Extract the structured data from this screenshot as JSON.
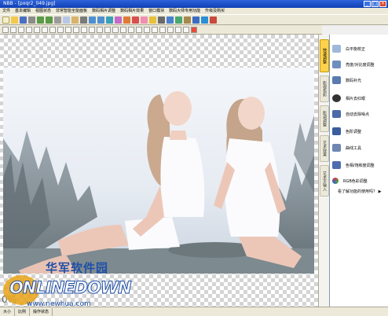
{
  "window": {
    "title": "NBB - [pxqr2_049.jpg]",
    "buttons": [
      "_",
      "□",
      "×"
    ]
  },
  "menu": [
    "文件",
    "基本编辑",
    "视图状态",
    "非常智能全能面板",
    "数码相片调整",
    "数码相片效果",
    "窗口模块",
    "数码大师专用功能",
    "升级及购买"
  ],
  "panel": {
    "items": [
      {
        "label": "白平衡校正",
        "icon": "white-balance-icon",
        "color": "#9fb7d9"
      },
      {
        "label": "亮度/对比度调整",
        "icon": "brightness-icon",
        "color": "#6e8fbf"
      },
      {
        "label": "数码补光",
        "icon": "fill-light-icon",
        "color": "#5a7ab0"
      },
      {
        "label": "相片去红眼",
        "icon": "red-eye-icon",
        "color": "#333333"
      },
      {
        "label": "自动去除噪点",
        "icon": "denoise-icon",
        "color": "#4a6aa8"
      },
      {
        "label": "色阶调整",
        "icon": "levels-icon",
        "color": "#3b5c9e"
      },
      {
        "label": "曲线工具",
        "icon": "curves-icon",
        "color": "#6f86b0"
      },
      {
        "label": "色相/饱和度调整",
        "icon": "hue-icon",
        "color": "#4d6dae"
      },
      {
        "label": "RGB色彩调整",
        "icon": "rgb-icon",
        "color": "#d04040"
      }
    ],
    "help_link": "看了解功能的使用吗？",
    "link_icon": "arrow-right-icon"
  },
  "vtabs": [
    "快速调整",
    "影视色彩",
    "影调调整",
    "艺术效果",
    "艺术字输入"
  ],
  "canvas": {
    "zoom_hint": "0%"
  },
  "watermark": {
    "cn": "华军软件园",
    "logo": "ONLINEDOWN",
    "url": "www.newhua.com"
  },
  "status": [
    "大小",
    "比例",
    "操作状态"
  ]
}
